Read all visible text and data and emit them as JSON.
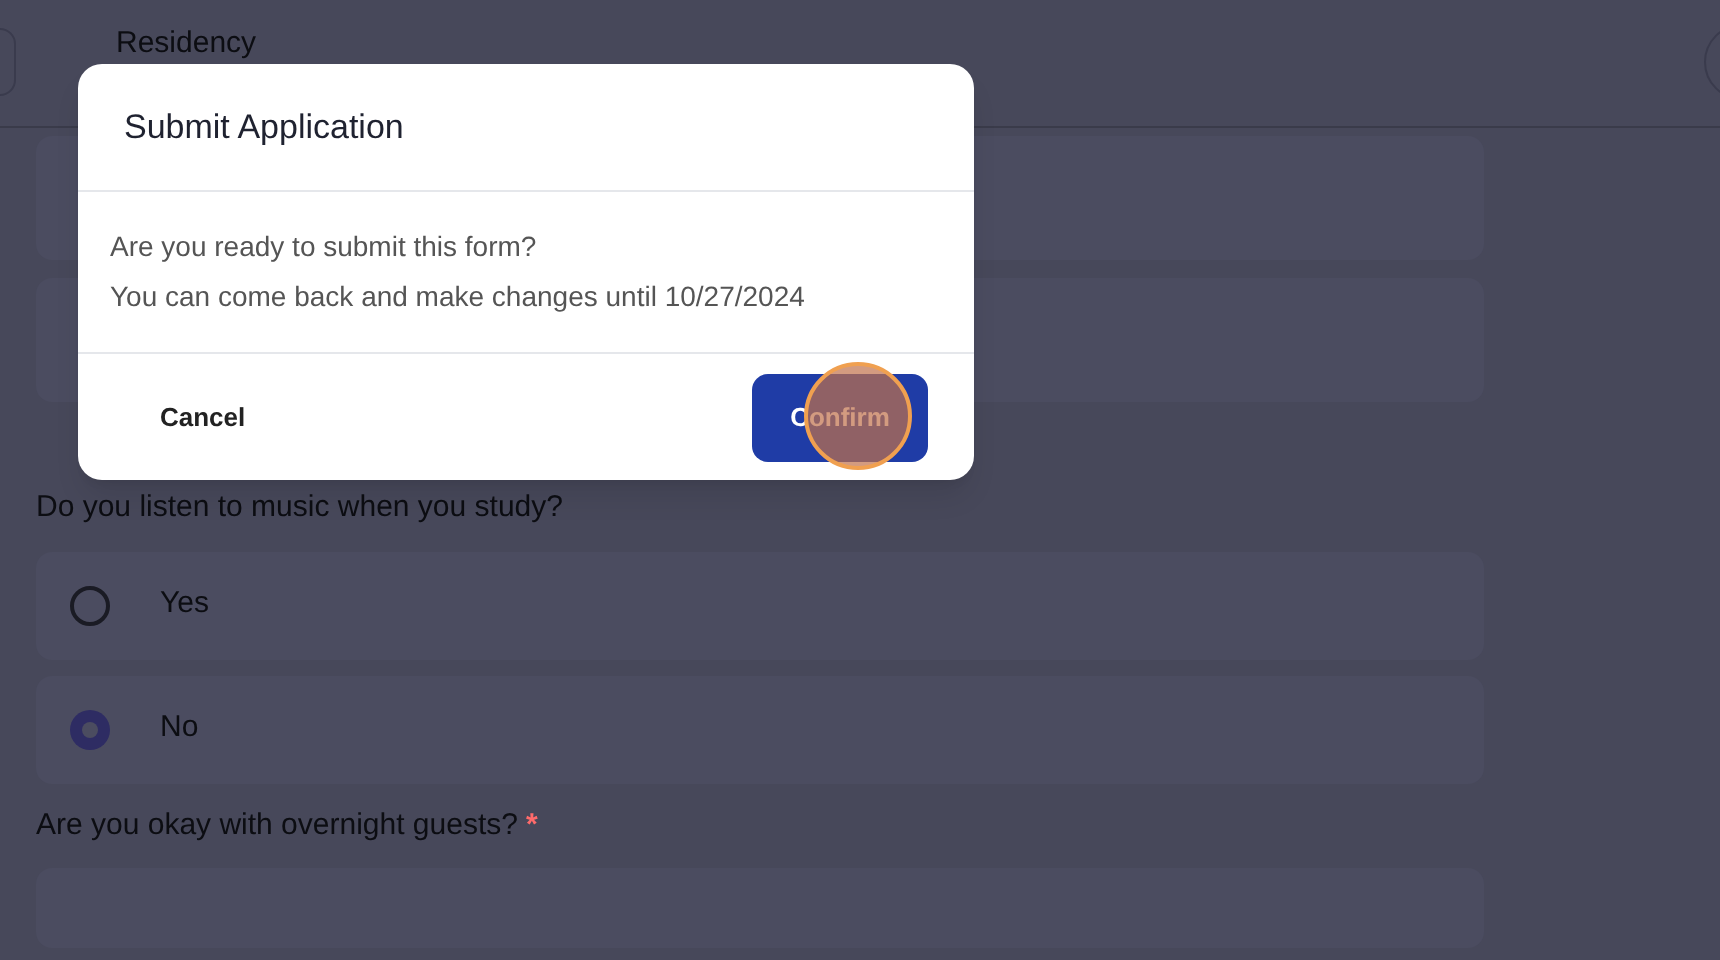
{
  "header": {
    "tab": "Residency"
  },
  "questions": [
    {
      "text": "Do you listen to music when you study?",
      "options": [
        {
          "label": "Yes",
          "selected": false
        },
        {
          "label": "No",
          "selected": true
        }
      ]
    },
    {
      "text": "Are you okay with overnight guests?",
      "required_mark": "*"
    }
  ],
  "dialog": {
    "title": "Submit Application",
    "body": [
      "Are you ready to submit this form?",
      "You can come back and make changes until 10/27/2024"
    ],
    "cancel": "Cancel",
    "confirm": "Confirm"
  }
}
